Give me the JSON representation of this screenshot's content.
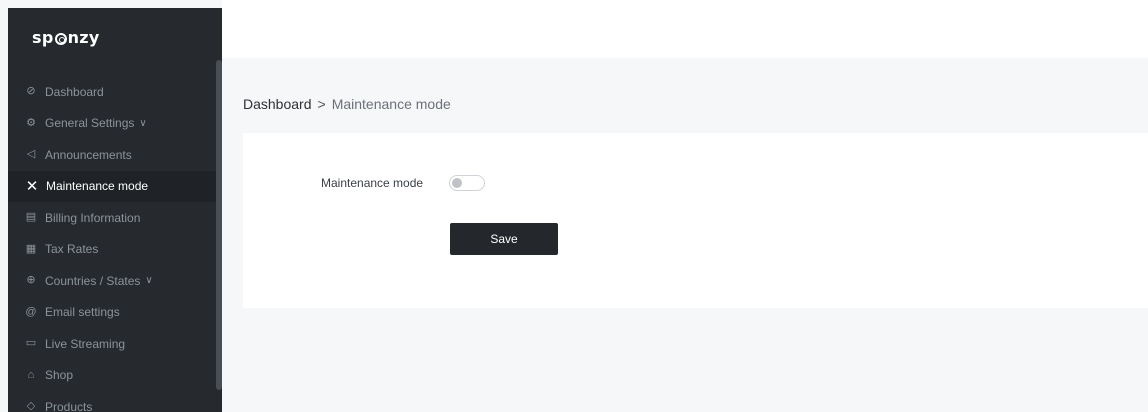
{
  "brand": {
    "logo_prefix": "sp",
    "logo_suffix": "nzy"
  },
  "sidebar": {
    "items": [
      {
        "label": "Dashboard",
        "icon": "speedometer-icon",
        "glyph": "⊘"
      },
      {
        "label": "General Settings",
        "icon": "gear-icon",
        "glyph": "⚙",
        "chevron": "∨"
      },
      {
        "label": "Announcements",
        "icon": "megaphone-icon",
        "glyph": "◁"
      },
      {
        "label": "Maintenance mode",
        "icon": "tools-icon",
        "glyph": "✕",
        "active": true
      },
      {
        "label": "Billing Information",
        "icon": "document-icon",
        "glyph": "▤"
      },
      {
        "label": "Tax Rates",
        "icon": "receipt-icon",
        "glyph": "▦"
      },
      {
        "label": "Countries / States",
        "icon": "globe-icon",
        "glyph": "⊕",
        "chevron": "∨"
      },
      {
        "label": "Email settings",
        "icon": "at-icon",
        "glyph": "@"
      },
      {
        "label": "Live Streaming",
        "icon": "video-icon",
        "glyph": "▭"
      },
      {
        "label": "Shop",
        "icon": "shop-icon",
        "glyph": "⌂"
      },
      {
        "label": "Products",
        "icon": "tag-icon",
        "glyph": "◇"
      }
    ]
  },
  "breadcrumb": {
    "root": "Dashboard",
    "separator": ">",
    "current": "Maintenance mode"
  },
  "form": {
    "maintenance_label": "Maintenance mode",
    "maintenance_enabled": false,
    "save_label": "Save"
  },
  "colors": {
    "sidebar_bg": "#262a2e",
    "active_item_bg": "#1f2226",
    "button_bg": "#24272b",
    "page_bg": "#f6f7f9"
  }
}
